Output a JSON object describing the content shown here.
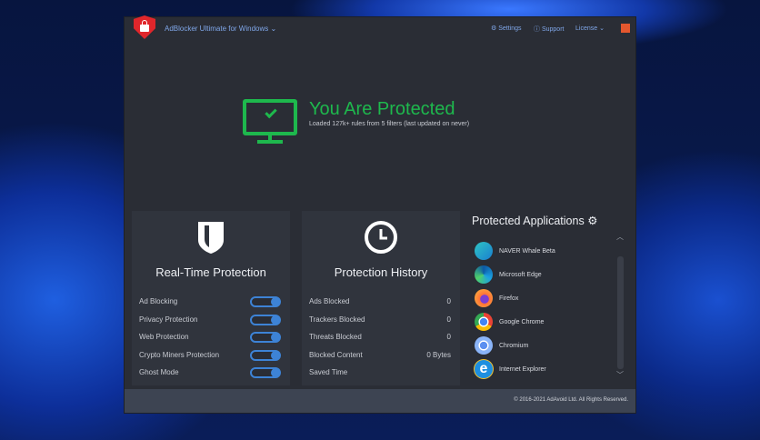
{
  "header": {
    "title": "AdBlocker Ultimate for Windows",
    "settings": "Settings",
    "support": "Support",
    "license": "License"
  },
  "status": {
    "title": "You Are Protected",
    "subtitle": "Loaded 127k+ rules from 5 filters (last updated on never)",
    "color": "#1eb84d"
  },
  "realtime": {
    "title": "Real-Time Protection",
    "items": [
      {
        "label": "Ad Blocking",
        "on": true
      },
      {
        "label": "Privacy Protection",
        "on": true
      },
      {
        "label": "Web Protection",
        "on": true
      },
      {
        "label": "Crypto Miners Protection",
        "on": true
      },
      {
        "label": "Ghost Mode",
        "on": true
      }
    ]
  },
  "history": {
    "title": "Protection History",
    "items": [
      {
        "label": "Ads Blocked",
        "value": "0"
      },
      {
        "label": "Trackers Blocked",
        "value": "0"
      },
      {
        "label": "Threats Blocked",
        "value": "0"
      },
      {
        "label": "Blocked Content",
        "value": "0 Bytes"
      },
      {
        "label": "Saved Time",
        "value": ""
      }
    ]
  },
  "apps": {
    "title": "Protected Applications",
    "items": [
      {
        "label": "NAVER Whale Beta"
      },
      {
        "label": "Microsoft Edge"
      },
      {
        "label": "Firefox"
      },
      {
        "label": "Google Chrome"
      },
      {
        "label": "Chromium"
      },
      {
        "label": "Internet Explorer"
      }
    ]
  },
  "footer": {
    "copyright": "© 2016-2021 AdAvoid Ltd. All Rights Reserved."
  }
}
